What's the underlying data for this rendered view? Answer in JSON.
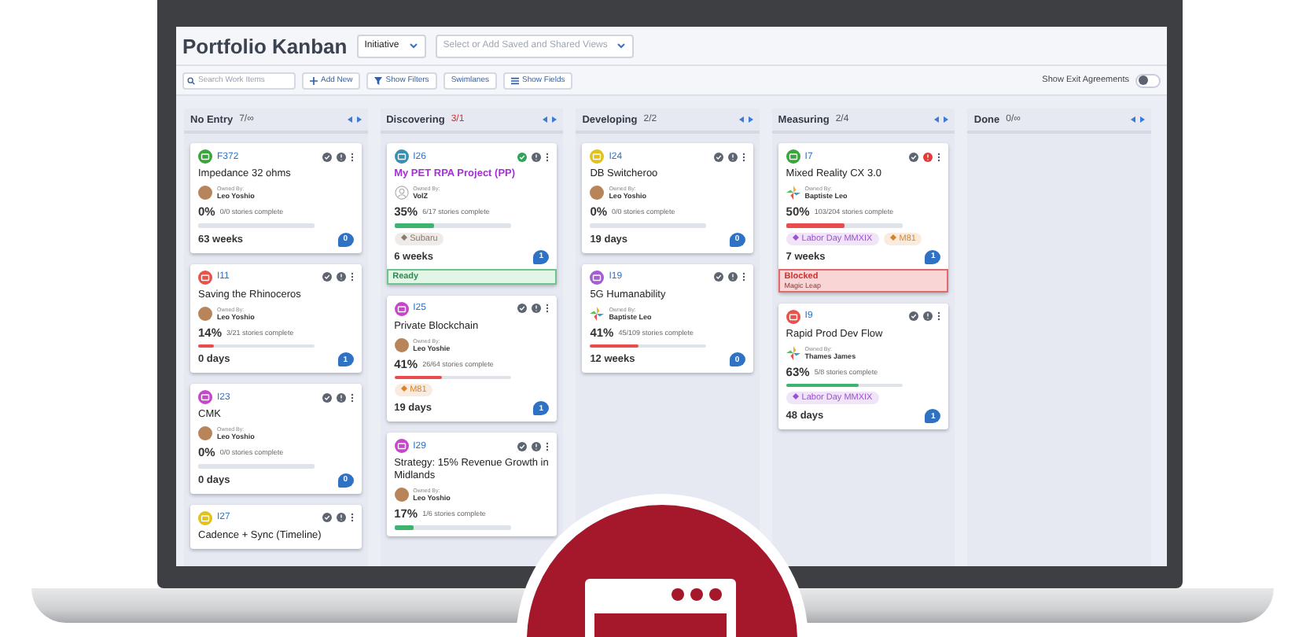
{
  "app": {
    "title": "Portfolio Kanban",
    "level_select": "Initiative",
    "views_select": {
      "placeholder": "Select or Add Saved and Shared Views"
    }
  },
  "toolbar": {
    "search": {
      "placeholder": "Search Work Items"
    },
    "buttons": [
      {
        "label": "Add New",
        "kind": "add"
      },
      {
        "label": "Show Filters",
        "kind": "filter"
      },
      {
        "label": "Swimlanes",
        "kind": "plain"
      },
      {
        "label": "Show Fields",
        "kind": "fields"
      }
    ],
    "exit_agreements": {
      "label": "Show Exit Agreements",
      "on": false
    }
  },
  "columns": [
    {
      "name": "No Entry",
      "count": "7/∞",
      "over_limit": false,
      "cards": [
        {
          "id": "F372",
          "color": "#3aa53a",
          "title": "Impedance 32 ohms",
          "highlighted": false,
          "approved": false,
          "alert": false,
          "owner": {
            "label": "Owned By:",
            "name": "Leo Yoshio",
            "kind": "photo"
          },
          "percent": "0%",
          "stories": "0/0 stories complete",
          "progress": {
            "level": 0
          },
          "duration": "63 weeks",
          "comments": "0"
        },
        {
          "id": "I11",
          "color": "#e8524a",
          "title": "Saving the Rhinoceros",
          "highlighted": false,
          "approved": false,
          "alert": false,
          "owner": {
            "label": "Owned By:",
            "name": "Leo Yoshio",
            "kind": "photo"
          },
          "percent": "14%",
          "stories": "3/21 stories complete",
          "progress": {
            "level": 0.14,
            "color": "#e84c4c"
          },
          "duration": "0 days",
          "comments": "1"
        },
        {
          "id": "I23",
          "color": "#c548c9",
          "title": "CMK",
          "highlighted": false,
          "approved": false,
          "alert": false,
          "owner": {
            "label": "Owned By:",
            "name": "Leo Yoshio",
            "kind": "photo"
          },
          "percent": "0%",
          "stories": "0/0 stories complete",
          "progress": {
            "level": 0
          },
          "duration": "0 days",
          "comments": "0"
        },
        {
          "id": "I27",
          "color": "#e0c21c",
          "title": "Cadence + Sync (Timeline)",
          "highlighted": false,
          "approved": false,
          "alert": false
        }
      ]
    },
    {
      "name": "Discovering",
      "count": "3/1",
      "over_limit": true,
      "cards": [
        {
          "id": "I26",
          "color": "#3a8fb0",
          "title": "My PET RPA Project (PP)",
          "highlighted": true,
          "approved": true,
          "alert": false,
          "owner": {
            "label": "Owned By:",
            "name": "VolZ",
            "kind": "blank"
          },
          "percent": "35%",
          "stories": "6/17 stories complete",
          "progress": {
            "level": 0.35,
            "color": "#3cb46e"
          },
          "tags": [
            {
              "label": "Subaru",
              "color": "#8c7b68"
            }
          ],
          "duration": "6 weeks",
          "comments": "1",
          "banner": {
            "kind": "ready",
            "label": "Ready"
          }
        },
        {
          "id": "I25",
          "color": "#c548c9",
          "title": "Private Blockchain",
          "highlighted": false,
          "approved": false,
          "alert": false,
          "owner": {
            "label": "Owned By:",
            "name": "Leo Yoshie",
            "kind": "photo"
          },
          "percent": "41%",
          "stories": "26/64 stories complete",
          "progress": {
            "level": 0.41,
            "color": "#e84c4c"
          },
          "tags": [
            {
              "label": "M81",
              "color": "#d9822b"
            }
          ],
          "duration": "19 days",
          "comments": "1"
        },
        {
          "id": "I29",
          "color": "#c548c9",
          "title": "Strategy: 15% Revenue Growth in Midlands",
          "highlighted": false,
          "approved": false,
          "alert": false,
          "owner": {
            "label": "Owned By:",
            "name": "Leo Yoshio",
            "kind": "photo"
          },
          "percent": "17%",
          "stories": "1/6 stories complete",
          "progress": {
            "level": 0.17,
            "color": "#3cb46e"
          }
        }
      ]
    },
    {
      "name": "Developing",
      "count": "2/2",
      "over_limit": false,
      "cards": [
        {
          "id": "I24",
          "color": "#e0c21c",
          "title": "DB Switcheroo",
          "highlighted": false,
          "approved": false,
          "alert": false,
          "owner": {
            "label": "Owned By:",
            "name": "Leo Yoshio",
            "kind": "photo"
          },
          "percent": "0%",
          "stories": "0/0 stories complete",
          "progress": {
            "level": 0
          },
          "duration": "19 days",
          "comments": "0"
        },
        {
          "id": "I19",
          "color": "#a35fd1",
          "title": "5G Humanability",
          "highlighted": false,
          "approved": false,
          "alert": false,
          "owner": {
            "label": "Owned By:",
            "name": "Baptiste Leo",
            "kind": "logo"
          },
          "percent": "41%",
          "stories": "45/109 stories complete",
          "progress": {
            "level": 0.41,
            "color": "#e84c4c"
          },
          "duration": "12 weeks",
          "comments": "0"
        }
      ]
    },
    {
      "name": "Measuring",
      "count": "2/4",
      "over_limit": false,
      "cards": [
        {
          "id": "I7",
          "color": "#3aa53a",
          "title": "Mixed Reality CX 3.0",
          "highlighted": false,
          "approved": false,
          "alert": true,
          "owner": {
            "label": "Owned By:",
            "name": "Baptiste Leo",
            "kind": "logo"
          },
          "percent": "50%",
          "stories": "103/204 stories complete",
          "progress": {
            "level": 0.5,
            "color": "#e84c4c"
          },
          "tags": [
            {
              "label": "Labor Day MMXIX",
              "color": "#9b4fd1"
            },
            {
              "label": "M81",
              "color": "#d9822b"
            }
          ],
          "duration": "7 weeks",
          "comments": "1",
          "banner": {
            "kind": "blocked",
            "label": "Blocked",
            "detail": "Magic Leap"
          }
        },
        {
          "id": "I9",
          "color": "#e8524a",
          "title": "Rapid Prod Dev Flow",
          "highlighted": false,
          "approved": false,
          "alert": false,
          "owner": {
            "label": "Owned By:",
            "name": "Thames James",
            "kind": "logo"
          },
          "percent": "63%",
          "stories": "5/8 stories complete",
          "progress": {
            "level": 0.63,
            "color": "#3cb46e"
          },
          "tags": [
            {
              "label": "Labor Day MMXIX",
              "color": "#9b4fd1"
            }
          ],
          "duration": "48 days",
          "comments": "1"
        }
      ]
    },
    {
      "name": "Done",
      "count": "0/∞",
      "over_limit": false
    }
  ]
}
